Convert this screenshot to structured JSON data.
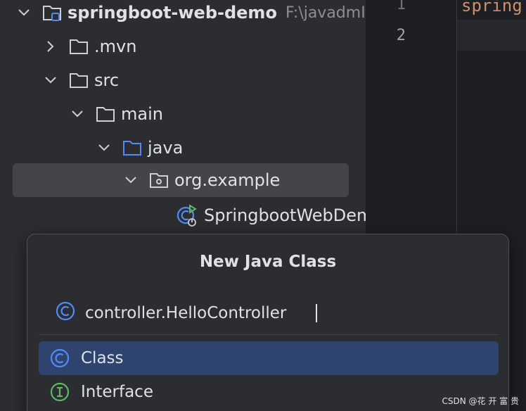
{
  "tree": {
    "project": {
      "name": "springboot-web-demo",
      "path": "F:\\javadmID"
    },
    "items": [
      {
        "label": ".mvn"
      },
      {
        "label": "src"
      },
      {
        "label": "main"
      },
      {
        "label": "java"
      },
      {
        "label": "org.example"
      },
      {
        "label": "SpringbootWebDem"
      }
    ]
  },
  "editor": {
    "line_numbers": [
      "1",
      "2"
    ],
    "code_fragment": "spring"
  },
  "dialog": {
    "title": "New Java Class",
    "name_value": "controller.HelloController",
    "kinds": [
      {
        "label": "Class",
        "selected": true
      },
      {
        "label": "Interface",
        "selected": false
      }
    ]
  },
  "watermark": "CSDN @花 开 富 贵",
  "colors": {
    "background": "#2b2d30",
    "editor_bg": "#1e1f22",
    "selection": "#2e436e",
    "class_icon": "#548af7",
    "interface_icon": "#5fb865",
    "folder_blue": "#548af7",
    "run_green": "#5fb865"
  }
}
